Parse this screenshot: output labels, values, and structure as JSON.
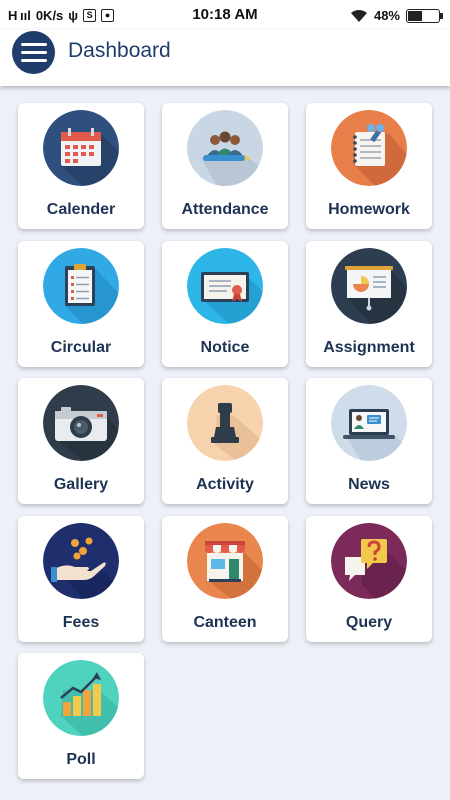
{
  "status_bar": {
    "signal": "H ııl",
    "speed": "0K/s",
    "time": "10:18 AM",
    "battery": "48%",
    "battery_level": 0.48
  },
  "app_bar": {
    "title": "Dashboard",
    "menu_icon": "hamburger-menu-icon"
  },
  "tiles": [
    {
      "label": "Calender",
      "icon": "calendar-icon",
      "color": "#2f4f7e"
    },
    {
      "label": "Attendance",
      "icon": "people-icon",
      "color": "#c9d6e3"
    },
    {
      "label": "Homework",
      "icon": "notebook-icon",
      "color": "#e87f4a"
    },
    {
      "label": "Circular",
      "icon": "clipboard-icon",
      "color": "#31a9e5"
    },
    {
      "label": "Notice",
      "icon": "certificate-icon",
      "color": "#2fb6e8"
    },
    {
      "label": "Assignment",
      "icon": "presentation-board-icon",
      "color": "#2d3e50"
    },
    {
      "label": "Gallery",
      "icon": "camera-icon",
      "color": "#2f3d4a"
    },
    {
      "label": "Activity",
      "icon": "chess-piece-icon",
      "color": "#f6d2ad"
    },
    {
      "label": "News",
      "icon": "laptop-news-icon",
      "color": "#cfdcea"
    },
    {
      "label": "Fees",
      "icon": "coins-hand-icon",
      "color": "#1f2f6e"
    },
    {
      "label": "Canteen",
      "icon": "shop-icon",
      "color": "#e8864e"
    },
    {
      "label": "Query",
      "icon": "question-bubble-icon",
      "color": "#7b2a5a"
    },
    {
      "label": "Poll",
      "icon": "bar-graph-icon",
      "color": "#4fd3bf"
    }
  ]
}
